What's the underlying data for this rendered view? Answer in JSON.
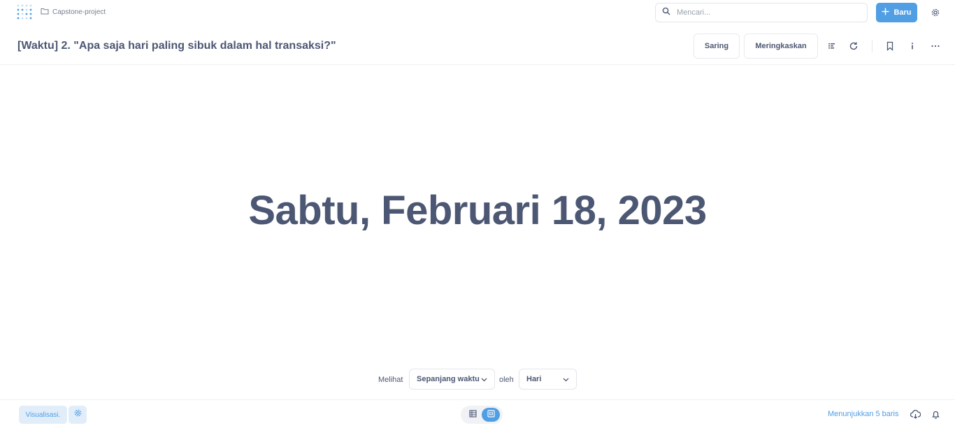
{
  "nav": {
    "breadcrumb": "Capstone-project",
    "search_placeholder": "Mencari...",
    "new_button": "Baru"
  },
  "question": {
    "title": "[Waktu] 2. \"Apa saja hari paling sibuk dalam hal transaksi?\"",
    "filter_button": "Saring",
    "summarize_button": "Meringkaskan"
  },
  "result": {
    "value": "Sabtu, Februari 18, 2023"
  },
  "filters": {
    "view_label": "Melihat",
    "range_value": "Sepanjang waktu",
    "by_label": "oleh",
    "unit_value": "Hari"
  },
  "footer": {
    "visualize_button": "Visualisasi.",
    "row_count": "Menunjukkan 5 baris"
  },
  "colors": {
    "brand": "#509ee3",
    "text": "#4c5773",
    "muted": "#74808f"
  }
}
